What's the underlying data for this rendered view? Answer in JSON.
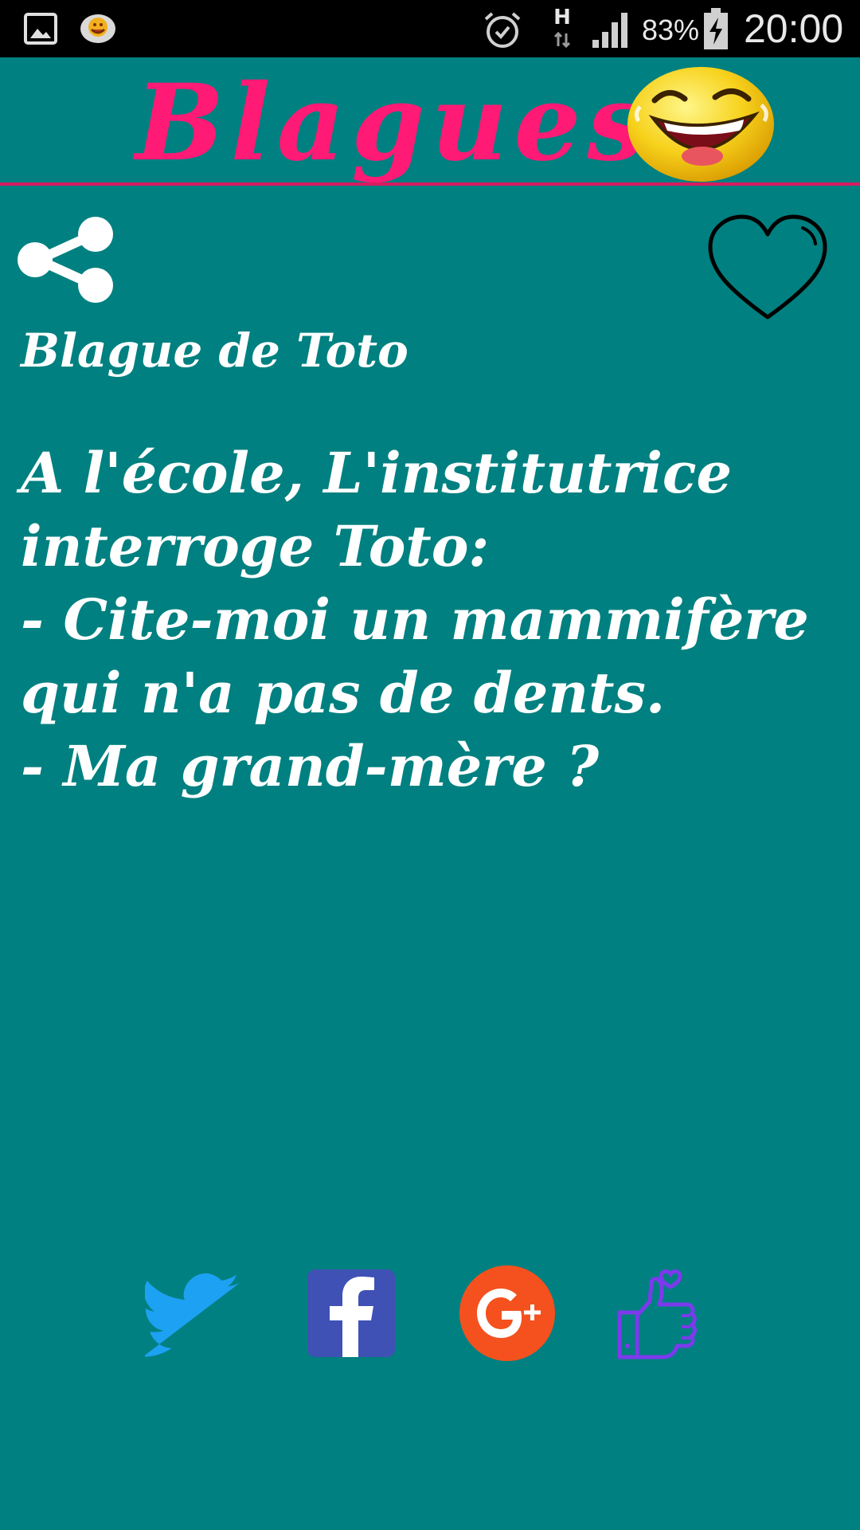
{
  "status_bar": {
    "network_type": "H",
    "battery_percent": "83%",
    "time": "20:00",
    "icons": [
      "gallery-icon",
      "app-notification-icon",
      "alarm-icon",
      "network-type-icon",
      "signal-icon",
      "battery-charging-icon"
    ]
  },
  "header": {
    "title": "Blagues",
    "emoji_icon": "laughing-face-icon"
  },
  "actions": {
    "share_icon": "share-icon",
    "favorite_icon": "heart-outline-icon"
  },
  "joke": {
    "category": "Blague de Toto",
    "lines": [
      "A l'école, L'institutrice",
      "interroge Toto:",
      "- Cite-moi un mammifère",
      "qui n'a pas de dents.",
      "- Ma grand-mère ?"
    ]
  },
  "social": {
    "buttons": [
      "twitter-icon",
      "facebook-icon",
      "google-plus-icon",
      "thumbs-up-heart-icon"
    ]
  },
  "colors": {
    "background": "#008080",
    "title": "#ff1a75",
    "divider": "#d81b60",
    "text": "#ffffff",
    "twitter": "#1da1f2",
    "facebook": "#3b5998",
    "google_plus": "#f4511e",
    "rate": "#7c3aed"
  }
}
